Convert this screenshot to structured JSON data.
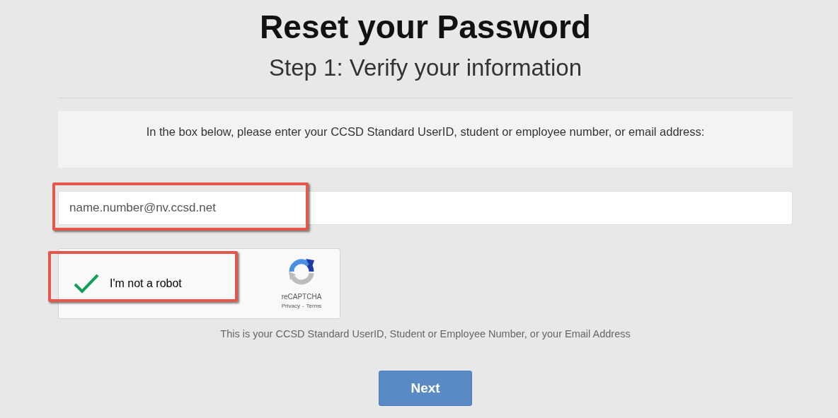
{
  "title": "Reset your Password",
  "subtitle": "Step 1: Verify your information",
  "instructions": "In the box below, please enter your CCSD Standard UserID, student or employee number, or email address:",
  "user_field": {
    "value": "name.number@nv.ccsd.net",
    "highlighted": true
  },
  "captcha": {
    "label": "I'm not a robot",
    "checked": true,
    "highlighted": true,
    "brand": "reCAPTCHA",
    "links": [
      "Privacy",
      "-",
      "Terms"
    ]
  },
  "help_text": "This is your CCSD Standard UserID, Student or Employee Number, or your Email Address",
  "buttons": [
    "Next"
  ]
}
